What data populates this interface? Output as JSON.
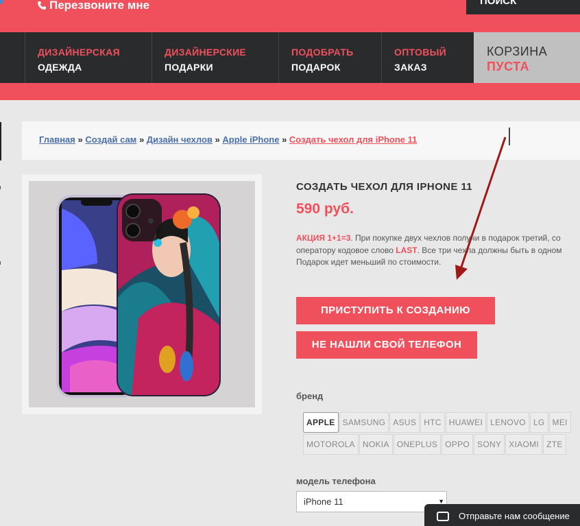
{
  "header": {
    "callback_label": "Перезвоните мне",
    "search_label": "ПОИСК"
  },
  "nav": [
    {
      "line1": "ДИЗАЙНЕРСКАЯ",
      "line2": "ОДЕЖДА"
    },
    {
      "line1": "ДИЗАЙНЕРСКИЕ",
      "line2": "ПОДАРКИ"
    },
    {
      "line1": "ПОДОБРАТЬ",
      "line2": "ПОДАРОК"
    },
    {
      "line1": "ОПТОВЫЙ",
      "line2": "ЗАКАЗ"
    }
  ],
  "cart": {
    "line1": "КОРЗИНА",
    "line2": "ПУСТА"
  },
  "breadcrumbs": {
    "items": [
      "Главная",
      "Создай сам",
      "Дизайн чехлов",
      "Apple iPhone",
      "Создать чехол для iPhone 11"
    ],
    "separator": "»"
  },
  "product": {
    "title": "СОЗДАТЬ ЧЕХОЛ ДЛЯ IPHONE 11",
    "price": "590 руб.",
    "promo_label": "АКЦИЯ 1+1=3",
    "promo_line1": ". При покупке двух чехлов получи в подарок третий, со",
    "promo_line2_a": "оператору кодовое слово ",
    "promo_code": "LAST",
    "promo_line2_b": ". Все три чехла должны быть в одном",
    "promo_line3": "Подарок идет меньший по стоимости."
  },
  "buttons": {
    "start": "ПРИСТУПИТЬ К СОЗДАНИЮ",
    "not_found": "НЕ НАШЛИ СВОЙ ТЕЛЕФОН"
  },
  "brand_label": "бренд",
  "brands_row1": [
    "APPLE",
    "SAMSUNG",
    "ASUS",
    "HTC",
    "HUAWEI",
    "LENOVO",
    "LG",
    "MEI"
  ],
  "brands_row2": [
    "MOTOROLA",
    "NOKIA",
    "ONEPLUS",
    "OPPO",
    "SONY",
    "XIAOMI",
    "ZTE"
  ],
  "selected_brand": "APPLE",
  "model_label": "модель телефона",
  "model_value": "iPhone 11",
  "chat_label": "Отправьте нам сообщение",
  "colors": {
    "accent": "#f0505b",
    "dark": "#2a2b2d",
    "annotation_arrow": "#a01818"
  }
}
